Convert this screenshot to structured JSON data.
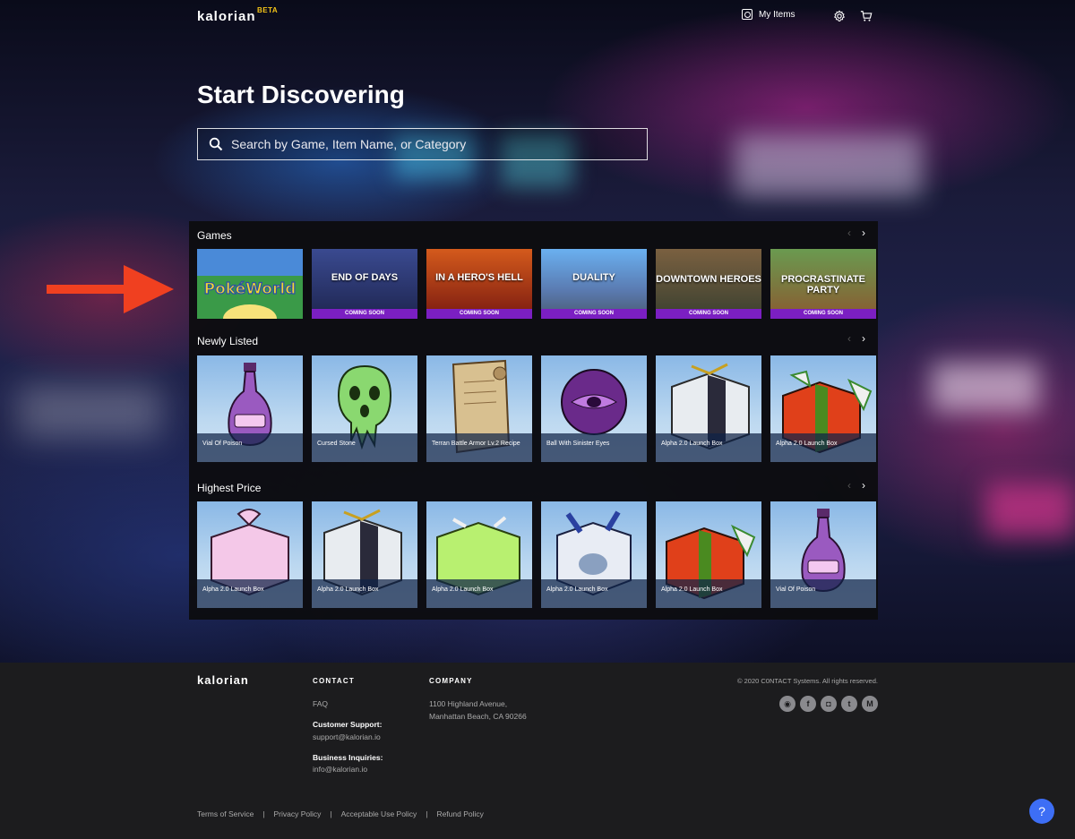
{
  "nav": {
    "logo": "kalorian",
    "beta": "BETA",
    "my_items": "My Items"
  },
  "hero": {
    "title": "Start Discovering",
    "search_placeholder": "Search by Game, Item Name, or Category"
  },
  "sections": {
    "games": {
      "title": "Games",
      "items": [
        {
          "title": "PokéWorld",
          "badge": ""
        },
        {
          "title": "END OF DAYS",
          "badge": "COMING SOON"
        },
        {
          "title": "IN A HERO'S HELL",
          "badge": "COMING SOON"
        },
        {
          "title": "DUALITY",
          "badge": "COMING SOON"
        },
        {
          "title": "DOWNTOWN HEROES",
          "badge": "COMING SOON"
        },
        {
          "title": "PROCRASTINATE PARTY",
          "badge": "COMING SOON"
        }
      ]
    },
    "newly_listed": {
      "title": "Newly Listed",
      "items": [
        {
          "name": "Vial Of Poison"
        },
        {
          "name": "Cursed Stone"
        },
        {
          "name": "Terran Battle Armor Lv.2 Recipe"
        },
        {
          "name": "Ball With Sinister Eyes"
        },
        {
          "name": "Alpha 2.0 Launch Box"
        },
        {
          "name": "Alpha 2.0 Launch Box"
        }
      ]
    },
    "highest_price": {
      "title": "Highest Price",
      "items": [
        {
          "name": "Alpha 2.0 Launch Box"
        },
        {
          "name": "Alpha 2.0 Launch Box"
        },
        {
          "name": "Alpha 2.0 Launch Box"
        },
        {
          "name": "Alpha 2.0 Launch Box"
        },
        {
          "name": "Alpha 2.0 Launch Box"
        },
        {
          "name": "Vial Of Poison"
        }
      ]
    }
  },
  "footer": {
    "logo": "kalorian",
    "contact_heading": "CONTACT",
    "faq": "FAQ",
    "support_label": "Customer Support:",
    "support_email": "support@kalorian.io",
    "business_label": "Business Inquiries:",
    "business_email": "info@kalorian.io",
    "company_heading": "COMPANY",
    "address_line1": "1100 Highland Avenue,",
    "address_line2": "Manhattan Beach, CA 90266",
    "copyright": "© 2020 C0NTACT Systems. All rights reserved.",
    "legal": [
      "Terms of Service",
      "Privacy Policy",
      "Acceptable Use Policy",
      "Refund Policy"
    ],
    "help": "?"
  },
  "colors": {
    "accent_badge": "#7b1fc2",
    "help_button": "#3d6ef5",
    "beta": "#f5c518",
    "arrow": "#f04020"
  },
  "icons": [
    "my-items-icon",
    "gear-icon",
    "cart-icon",
    "search-icon",
    "discord-icon",
    "facebook-icon",
    "instagram-icon",
    "twitter-icon",
    "medium-icon"
  ]
}
